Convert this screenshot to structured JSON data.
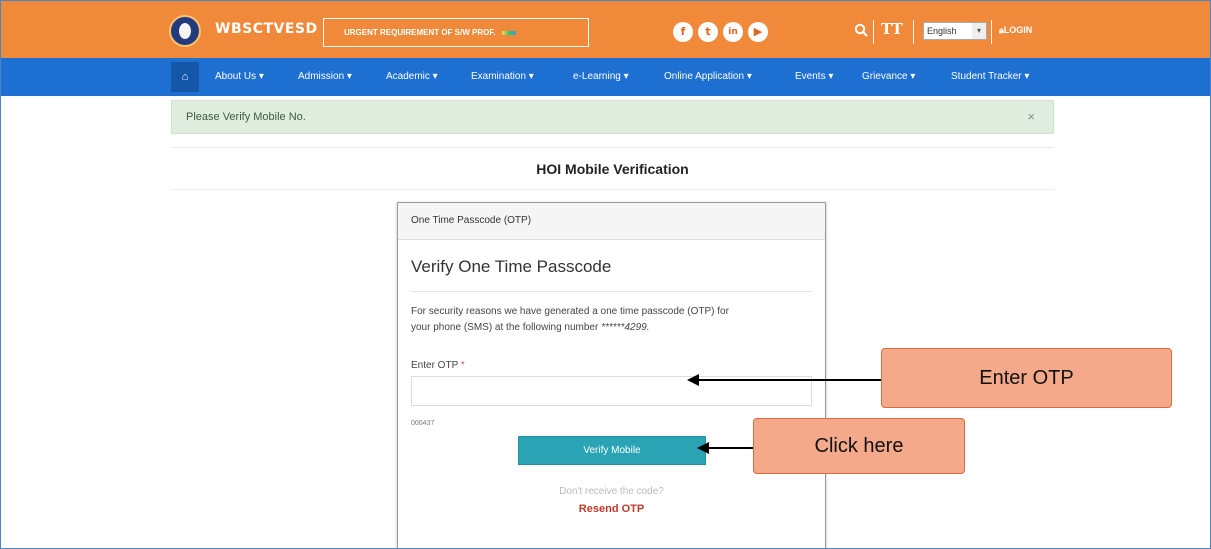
{
  "header": {
    "brand": "WBSCTVESD",
    "ticker_text": "URGENT REQUIREMENT OF S/W PROF.",
    "social": [
      "facebook-icon",
      "twitter-icon",
      "linkedin-icon",
      "youtube-icon"
    ],
    "text_size_label": "TT",
    "language": "English",
    "login_label": "LOGIN",
    "colors": {
      "topbar": "#f08a3a",
      "navbar": "#1d6fd1"
    }
  },
  "nav": {
    "items": [
      "About Us",
      "Admission",
      "Academic",
      "Examination",
      "e-Learning",
      "Online Application",
      "Events",
      "Grievance",
      "Student Tracker"
    ]
  },
  "alert": {
    "message": "Please Verify Mobile No.",
    "close": "×"
  },
  "page_title": "HOI Mobile Verification",
  "card": {
    "header": "One Time Passcode (OTP)",
    "title": "Verify One Time Passcode",
    "description_line1": "For security reasons we have generated a one time passcode (OTP) for",
    "description_line2": "your phone (SMS) at the following number",
    "masked_number": "******4299.",
    "otp_label": "Enter OTP",
    "required_mark": "*",
    "otp_value": "",
    "smudge_text": "000437",
    "verify_button": "Verify Mobile",
    "no_code_text": "Don't receive the code?",
    "resend_label": "Resend OTP"
  },
  "callouts": {
    "enter_otp": "Enter OTP",
    "click_here": "Click here"
  }
}
